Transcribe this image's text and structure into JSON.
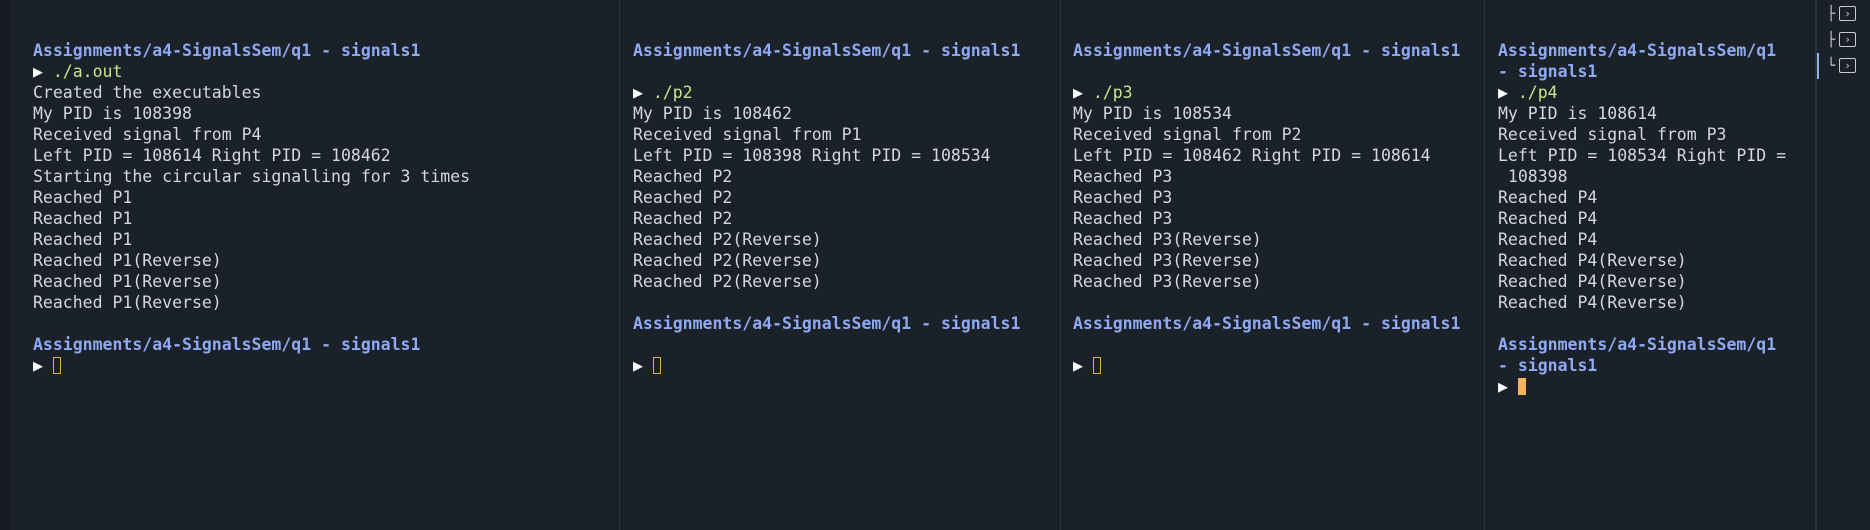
{
  "panes": [
    {
      "lines": [
        {
          "type": "path",
          "text": "Assignments/a4-SignalsSem/q1 - signals1"
        },
        {
          "type": "prompt",
          "cmd": "./a.out"
        },
        {
          "type": "out",
          "text": "Created the executables"
        },
        {
          "type": "out",
          "text": "My PID is 108398"
        },
        {
          "type": "out",
          "text": "Received signal from P4"
        },
        {
          "type": "out",
          "text": "Left PID = 108614 Right PID = 108462"
        },
        {
          "type": "out",
          "text": "Starting the circular signalling for 3 times"
        },
        {
          "type": "out",
          "text": "Reached P1"
        },
        {
          "type": "out",
          "text": "Reached P1"
        },
        {
          "type": "out",
          "text": "Reached P1"
        },
        {
          "type": "out",
          "text": "Reached P1(Reverse)"
        },
        {
          "type": "out",
          "text": "Reached P1(Reverse)"
        },
        {
          "type": "out",
          "text": "Reached P1(Reverse)"
        },
        {
          "type": "blank"
        },
        {
          "type": "path",
          "text": "Assignments/a4-SignalsSem/q1 - signals1"
        },
        {
          "type": "cursor",
          "active": false
        }
      ]
    },
    {
      "lines": [
        {
          "type": "path",
          "text": "Assignments/a4-SignalsSem/q1 - signals1"
        },
        {
          "type": "blank"
        },
        {
          "type": "prompt",
          "cmd": "./p2"
        },
        {
          "type": "out",
          "text": "My PID is 108462"
        },
        {
          "type": "out",
          "text": "Received signal from P1"
        },
        {
          "type": "out",
          "text": "Left PID = 108398 Right PID = 108534"
        },
        {
          "type": "out",
          "text": "Reached P2"
        },
        {
          "type": "out",
          "text": "Reached P2"
        },
        {
          "type": "out",
          "text": "Reached P2"
        },
        {
          "type": "out",
          "text": "Reached P2(Reverse)"
        },
        {
          "type": "out",
          "text": "Reached P2(Reverse)"
        },
        {
          "type": "out",
          "text": "Reached P2(Reverse)"
        },
        {
          "type": "blank"
        },
        {
          "type": "path",
          "text": "Assignments/a4-SignalsSem/q1 - signals1"
        },
        {
          "type": "blank"
        },
        {
          "type": "cursor",
          "active": false
        }
      ]
    },
    {
      "lines": [
        {
          "type": "path",
          "text": "Assignments/a4-SignalsSem/q1 - signals1"
        },
        {
          "type": "blank"
        },
        {
          "type": "prompt",
          "cmd": "./p3"
        },
        {
          "type": "out",
          "text": "My PID is 108534"
        },
        {
          "type": "out",
          "text": "Received signal from P2"
        },
        {
          "type": "out",
          "text": "Left PID = 108462 Right PID = 108614"
        },
        {
          "type": "out",
          "text": "Reached P3"
        },
        {
          "type": "out",
          "text": "Reached P3"
        },
        {
          "type": "out",
          "text": "Reached P3"
        },
        {
          "type": "out",
          "text": "Reached P3(Reverse)"
        },
        {
          "type": "out",
          "text": "Reached P3(Reverse)"
        },
        {
          "type": "out",
          "text": "Reached P3(Reverse)"
        },
        {
          "type": "blank"
        },
        {
          "type": "path",
          "text": "Assignments/a4-SignalsSem/q1 - signals1"
        },
        {
          "type": "blank"
        },
        {
          "type": "cursor",
          "active": false
        }
      ]
    },
    {
      "lines": [
        {
          "type": "path",
          "text": "Assignments/a4-SignalsSem/q1"
        },
        {
          "type": "path",
          "text": "- signals1"
        },
        {
          "type": "prompt",
          "cmd": "./p4"
        },
        {
          "type": "out",
          "text": "My PID is 108614"
        },
        {
          "type": "out",
          "text": "Received signal from P3"
        },
        {
          "type": "out",
          "text": "Left PID = 108534 Right PID ="
        },
        {
          "type": "out",
          "text": " 108398"
        },
        {
          "type": "out",
          "text": "Reached P4"
        },
        {
          "type": "out",
          "text": "Reached P4"
        },
        {
          "type": "out",
          "text": "Reached P4"
        },
        {
          "type": "out",
          "text": "Reached P4(Reverse)"
        },
        {
          "type": "out",
          "text": "Reached P4(Reverse)"
        },
        {
          "type": "out",
          "text": "Reached P4(Reverse)"
        },
        {
          "type": "blank"
        },
        {
          "type": "path",
          "text": "Assignments/a4-SignalsSem/q1"
        },
        {
          "type": "path",
          "text": "- signals1"
        },
        {
          "type": "cursor",
          "active": true
        }
      ]
    }
  ],
  "prompt_glyph": "▶",
  "sidebar": {
    "items": [
      {
        "branch": "├",
        "icon": "terminal-icon"
      },
      {
        "branch": "├",
        "icon": "terminal-icon"
      },
      {
        "branch": "└",
        "icon": "terminal-icon",
        "active": true
      }
    ],
    "terminal_glyph": "›"
  },
  "colors": {
    "background": "#1b2129",
    "path": "#8fa9f2",
    "command": "#c5e88a",
    "output": "#d3d7de",
    "cursor": "#f2b35a"
  }
}
